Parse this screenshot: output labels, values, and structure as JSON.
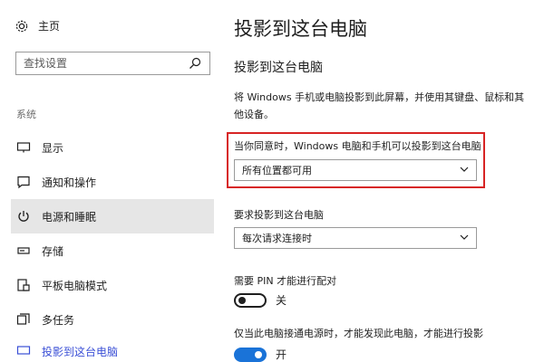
{
  "sidebar": {
    "home_label": "主页",
    "search_placeholder": "查找设置",
    "section_label": "系统",
    "items": [
      {
        "label": "显示",
        "icon": "monitor-icon"
      },
      {
        "label": "通知和操作",
        "icon": "notification-icon"
      },
      {
        "label": "电源和睡眠",
        "icon": "power-icon",
        "selected": true
      },
      {
        "label": "存储",
        "icon": "storage-icon"
      },
      {
        "label": "平板电脑模式",
        "icon": "tablet-mode-icon"
      },
      {
        "label": "多任务",
        "icon": "multitask-icon"
      },
      {
        "label": "投影到这台电脑",
        "icon": "project-icon"
      }
    ]
  },
  "main": {
    "title": "投影到这台电脑",
    "subtitle": "投影到这台电脑",
    "description": "将 Windows 手机或电脑投影到此屏幕，并使用其键盘、鼠标和其他设备。",
    "permission": {
      "label": "当你同意时，Windows 电脑和手机可以投影到这台电脑",
      "selected": "所有位置都可用"
    },
    "request": {
      "label": "要求投影到这台电脑",
      "selected": "每次请求连接时"
    },
    "pin": {
      "label": "需要 PIN 才能进行配对",
      "state_label": "关",
      "on": false
    },
    "power_discover": {
      "label": "仅当此电脑接通电源时，才能发现此电脑，才能进行投影",
      "state_label": "开",
      "on": true
    }
  },
  "colors": {
    "accent": "#1a73d8",
    "highlight": "#d72424",
    "selected_bg": "#e6e6e6"
  }
}
